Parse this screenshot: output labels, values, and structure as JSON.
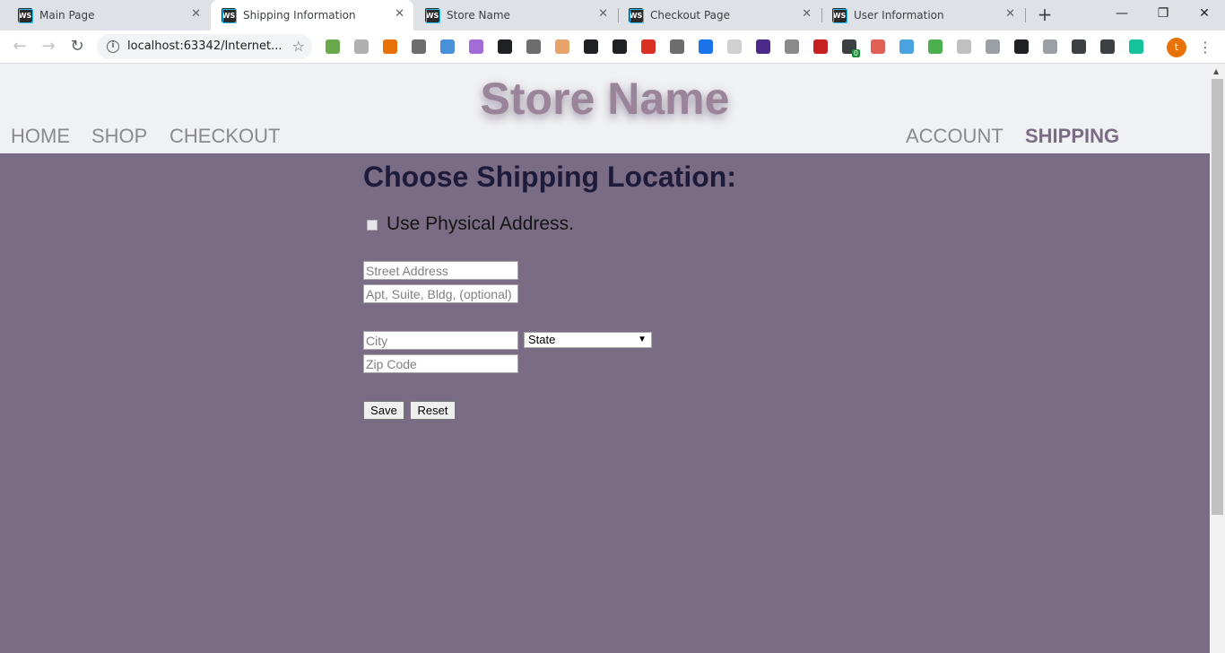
{
  "browser": {
    "tabs": [
      {
        "title": "Main Page",
        "favicon": "WS",
        "active": false
      },
      {
        "title": "Shipping Information",
        "favicon": "WS",
        "active": true
      },
      {
        "title": "Store Name",
        "favicon": "WS",
        "active": false
      },
      {
        "title": "Checkout Page",
        "favicon": "WS",
        "active": false
      },
      {
        "title": "User Information",
        "favicon": "WS",
        "active": false
      }
    ],
    "close_glyph": "✕",
    "new_tab_glyph": "+",
    "window_controls": {
      "minimize": "—",
      "restore": "❐",
      "close": "✕"
    },
    "nav": {
      "back": "←",
      "forward": "→",
      "reload": "↻"
    },
    "url": "localhost:63342/Internet...",
    "info_glyph": "i",
    "star_glyph": "☆",
    "profile_initial": "t",
    "menu_glyph": "⋮",
    "extension_colors": [
      "#6aa84f",
      "#b0b0b0",
      "#e8710a",
      "#6d6d6d",
      "#4a90d9",
      "#a36bd6",
      "#202124",
      "#6d6d6d",
      "#e8a36b",
      "#202124",
      "#202124",
      "#d93025",
      "#6d6d6d",
      "#1a73e8",
      "#d0d0d0",
      "#4b2a8a",
      "#8a8a8a",
      "#c5221f",
      "#3c4043",
      "#e06055",
      "#4aa3df",
      "#4caf50",
      "#c0c0c0",
      "#9aa0a6",
      "#202124",
      "#9aa0a6",
      "#3c4043",
      "#3c4043",
      "#15c39a"
    ],
    "extension_badge": "0"
  },
  "header": {
    "store_name": "Store Name",
    "nav_left": [
      "HOME",
      "SHOP",
      "CHECKOUT"
    ],
    "nav_right": [
      "ACCOUNT",
      "SHIPPING"
    ],
    "current": "SHIPPING"
  },
  "form": {
    "heading": "Choose Shipping Location:",
    "checkbox_label": "Use Physical Address.",
    "street_placeholder": "Street Address",
    "apt_placeholder": "Apt, Suite, Bldg, (optional)",
    "city_placeholder": "City",
    "state_selected": "State",
    "select_arrow": "▼",
    "zip_placeholder": "Zip Code",
    "save_label": "Save",
    "reset_label": "Reset"
  },
  "colors": {
    "page_background": "#7b6c85",
    "header_background": "#f0f1f4",
    "store_name": "#9a8499",
    "nav_link": "#8a8a8a",
    "nav_active": "#7b6c85",
    "heading": "#1e1a3a"
  }
}
